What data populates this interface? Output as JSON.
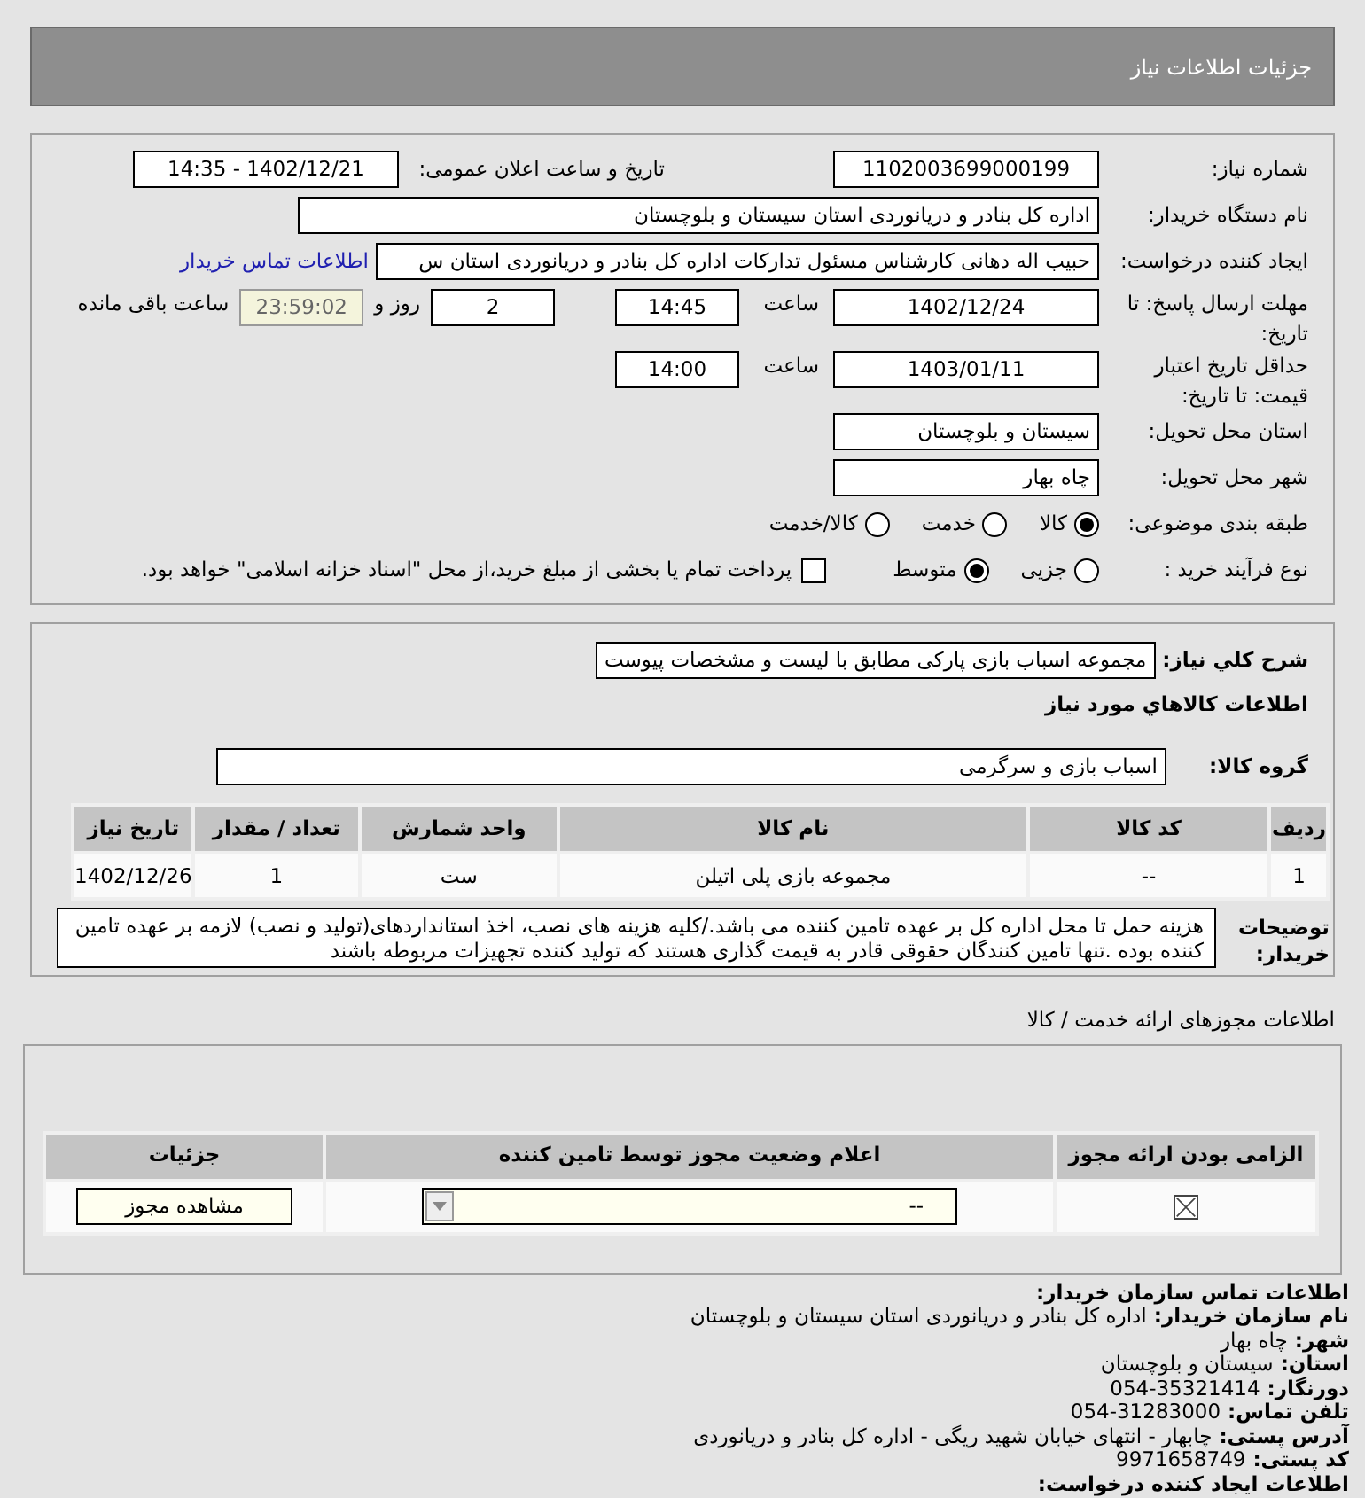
{
  "header": {
    "title": "جزئیات اطلاعات نیاز"
  },
  "need": {
    "need_number": {
      "label": "شماره نیاز:",
      "value": "1102003699000199"
    },
    "announce": {
      "label": "تاریخ و ساعت اعلان عمومی:",
      "value": "1402/12/21 - 14:35"
    },
    "buyer_org": {
      "label": "نام دستگاه خریدار:",
      "value": "اداره کل بنادر و دریانوردی استان سیستان و بلوچستان"
    },
    "requester": {
      "label": "ایجاد کننده درخواست:",
      "value": "حبیب اله دهانی کارشناس مسئول تدارکات اداره کل بنادر و دریانوردی استان س",
      "link": "اطلاعات تماس خریدار"
    },
    "response_deadline": {
      "label": "مهلت ارسال پاسخ: تا تاریخ:",
      "date": "1402/12/24",
      "time_label": "ساعت",
      "time": "14:45",
      "days": "2",
      "days_label": "روز و",
      "remaining": "23:59:02",
      "remaining_label": "ساعت باقی مانده"
    },
    "price_validity": {
      "label": "حداقل تاریخ اعتبار قیمت: تا تاریخ:",
      "date": "1403/01/11",
      "time_label": "ساعت",
      "time": "14:00"
    },
    "delivery_province": {
      "label": "استان محل تحویل:",
      "value": "سیستان و بلوچستان"
    },
    "delivery_city": {
      "label": "شهر محل تحویل:",
      "value": "چاه بهار"
    },
    "category": {
      "label": "طبقه بندی موضوعی:",
      "options": [
        {
          "label": "کالا",
          "selected": true
        },
        {
          "label": "خدمت",
          "selected": false
        },
        {
          "label": "کالا/خدمت",
          "selected": false
        }
      ]
    },
    "purchase_process": {
      "label": "نوع فرآیند خرید :",
      "options": [
        {
          "label": "جزیی",
          "selected": false
        },
        {
          "label": "متوسط",
          "selected": true
        }
      ],
      "payment": {
        "checked": false,
        "text": "پرداخت تمام یا بخشی از مبلغ خرید،از محل \"اسناد خزانه اسلامی\" خواهد بود."
      }
    }
  },
  "goods": {
    "description": {
      "label": "شرح کلي نياز:",
      "value": "مجموعه اسباب بازی پارکی مطابق با لیست و مشخصات پیوست"
    },
    "title": "اطلاعات کالاهاي مورد نياز",
    "group": {
      "label": "گروه کالا:",
      "value": "اسباب بازی و سرگرمی"
    },
    "table": {
      "columns": [
        "ردیف",
        "کد کالا",
        "نام کالا",
        "واحد شمارش",
        "تعداد / مقدار",
        "تاریخ نیاز"
      ],
      "rows": [
        [
          "1",
          "--",
          "مجموعه بازی پلی اتیلن",
          "ست",
          "1",
          "1402/12/26"
        ]
      ]
    },
    "buyer_notes": {
      "label": "توضیحات خریدار:",
      "text": "هزینه حمل تا محل اداره کل بر عهده تامین کننده می باشد./کلیه هزینه های نصب، اخذ استانداردهای(تولید و نصب) لازمه بر عهده تامین کننده بوده .تنها تامین کنندگان حقوقی قادر به قیمت گذاری هستند که تولید کننده تجهیزات مربوطه باشند"
    }
  },
  "permits": {
    "title": "اطلاعات مجوزهای ارائه خدمت / کالا",
    "columns": [
      "الزامی بودن ارائه مجوز",
      "اعلام وضعیت مجوز توسط تامین کننده",
      "جزئیات"
    ],
    "rows": [
      {
        "required": true,
        "status": "--",
        "button": "مشاهده مجوز"
      }
    ]
  },
  "contact": {
    "title": "اطلاعات تماس سازمان خریدار:",
    "lines": [
      {
        "label": "نام سازمان خریدار:",
        "value": "اداره کل بنادر و دریانوردی استان سیستان و بلوچستان"
      },
      {
        "label": "شهر:",
        "value": "چاه بهار"
      },
      {
        "label": "استان:",
        "value": "سیستان و بلوچستان"
      },
      {
        "label": "دورنگار:",
        "value": "054-35321414"
      },
      {
        "label": "تلفن تماس:",
        "value": "054-31283000"
      },
      {
        "label": "آدرس پستی:",
        "value": "چابهار - انتهای خیابان شهید ریگی - اداره کل بنادر و دریانوردی"
      },
      {
        "label": "کد پستی:",
        "value": "9971658749"
      }
    ],
    "creator_title": "اطلاعات ایجاد کننده درخواست:"
  }
}
